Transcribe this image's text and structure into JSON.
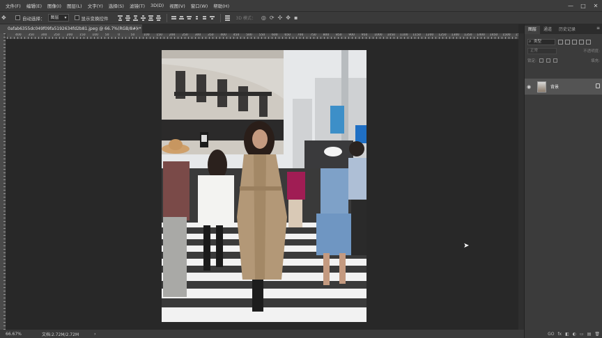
{
  "menubar": {
    "items": [
      "文件(F)",
      "编辑(E)",
      "图像(I)",
      "图层(L)",
      "文字(Y)",
      "选择(S)",
      "滤镜(T)",
      "3D(D)",
      "视图(V)",
      "窗口(W)",
      "帮助(H)"
    ],
    "window_controls": [
      "—",
      "□",
      "✕"
    ]
  },
  "options_bar": {
    "auto_select_label": "自动选择：",
    "auto_select_value": "图层",
    "show_transform_label": "显示变换控件",
    "mode_3d_label": "3D 模式："
  },
  "document": {
    "tab_title": "0afab6355dc049f09fa5192634fd2b81.jpeg @ 66.7%(RGB/8#) *",
    "close": "×"
  },
  "rulers": {
    "top_labels": [
      "400",
      "350",
      "300",
      "250",
      "200",
      "150",
      "100",
      "50",
      "0",
      "50",
      "100",
      "150",
      "200",
      "250",
      "300",
      "350",
      "400",
      "450",
      "500",
      "550",
      "600",
      "650",
      "700",
      "750",
      "800",
      "850",
      "900",
      "950",
      "1000",
      "1050",
      "1100",
      "1150",
      "1200",
      "1250",
      "1300",
      "1350",
      "1400",
      "1450",
      "1500",
      "1550"
    ]
  },
  "status": {
    "zoom": "66.67%",
    "doc_info": "文档:2.72M/2.72M",
    "arrow": "›"
  },
  "panel": {
    "tabs": [
      "图层",
      "通道",
      "历史记录"
    ],
    "active_tab": "图层",
    "menu": "≡",
    "kind_label": "类型",
    "blend_mode": "正常",
    "opacity_label": "不透明度:",
    "lock_label": "锁定:",
    "fill_label": "填充:",
    "layer_name": "背景",
    "footer_icons": [
      "GO",
      "fx",
      "◧",
      "◐",
      "▭",
      "▤",
      "🗑"
    ]
  },
  "colors": {
    "ui_dark": "#282828",
    "panel": "#3b3b3b",
    "selected_layer": "#545454"
  }
}
